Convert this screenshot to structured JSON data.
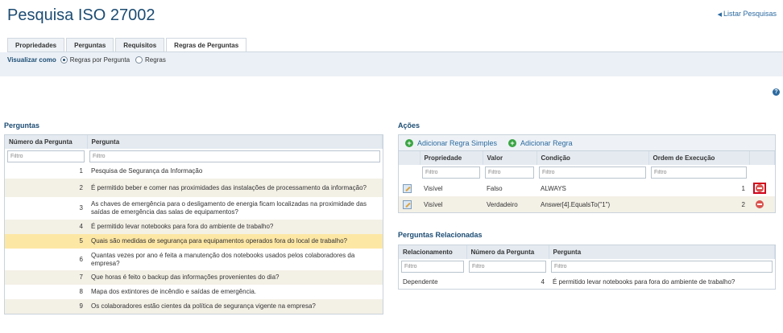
{
  "page": {
    "title": "Pesquisa ISO 27002",
    "list_link": "Listar Pesquisas"
  },
  "tabs": [
    {
      "label": "Propriedades"
    },
    {
      "label": "Perguntas"
    },
    {
      "label": "Requisitos"
    },
    {
      "label": "Regras de Perguntas",
      "active": true
    }
  ],
  "view": {
    "label": "Visualizar como",
    "options": [
      {
        "label": "Regras por Pergunta",
        "selected": true
      },
      {
        "label": "Regras",
        "selected": false
      }
    ]
  },
  "help_icon": "question-circle-icon",
  "perguntas": {
    "title": "Perguntas",
    "columns": [
      "Número da Pergunta",
      "Pergunta"
    ],
    "filter_placeholder": "Filtro",
    "rows": [
      {
        "num": "1",
        "text": "Pesquisa de Segurança da Informação"
      },
      {
        "num": "2",
        "text": "É permitido beber e comer nas proximidades das instalações de processamento da informação?"
      },
      {
        "num": "3",
        "text": "As chaves de emergência para o desligamento de energia ficam localizadas na proximidade das saídas de emergência das salas de equipamentos?"
      },
      {
        "num": "4",
        "text": "É permitido levar notebooks para fora do ambiente de trabalho?"
      },
      {
        "num": "5",
        "text": "Quais são medidas de segurança para equipamentos operados fora do local de trabalho?"
      },
      {
        "num": "6",
        "text": "Quantas vezes por ano é feita a manutenção dos notebooks usados pelos colaboradores da empresa?"
      },
      {
        "num": "7",
        "text": "Que horas é feito o backup das informações provenientes do dia?"
      },
      {
        "num": "8",
        "text": "Mapa dos extintores de incêndio e saídas de emergência."
      },
      {
        "num": "9",
        "text": "Os colaboradores estão cientes da política de segurança vigente na empresa?"
      }
    ]
  },
  "acoes": {
    "title": "Ações",
    "add_simple": "Adicionar Regra Simples",
    "add_rule": "Adicionar Regra",
    "columns": [
      "Propriedade",
      "Valor",
      "Condição",
      "Ordem de Execução"
    ],
    "filter_placeholder": "Filtro",
    "rows": [
      {
        "prop": "Visível",
        "valor": "Falso",
        "cond": "ALWAYS",
        "ordem": "1"
      },
      {
        "prop": "Visível",
        "valor": "Verdadeiro",
        "cond": "Answer[4].EqualsTo(\"1\")",
        "ordem": "2"
      }
    ]
  },
  "relacionadas": {
    "title": "Perguntas Relacionadas",
    "columns": [
      "Relacionamento",
      "Número da Pergunta",
      "Pergunta"
    ],
    "filter_placeholder": "Filtro",
    "rows": [
      {
        "rel": "Dependente",
        "num": "4",
        "text": "É permitido levar notebooks para fora do ambiente de trabalho?"
      }
    ]
  }
}
